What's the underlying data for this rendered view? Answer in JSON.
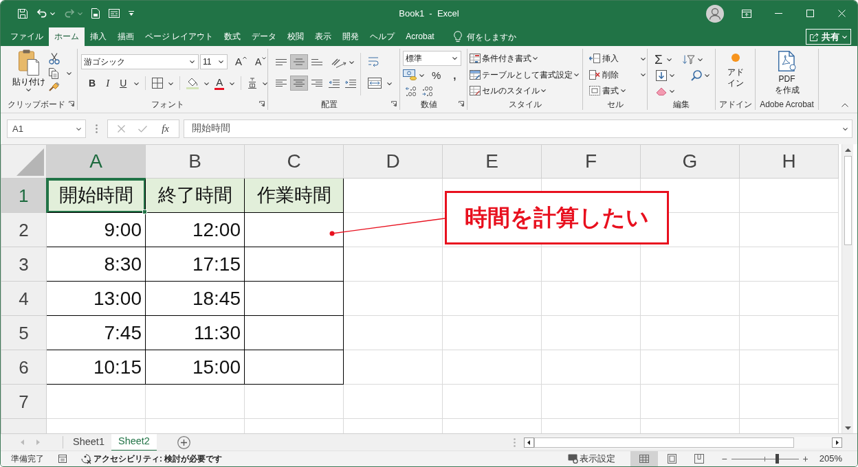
{
  "window": {
    "title": "Book1  -  Excel"
  },
  "quick_access": [
    {
      "kind": "save",
      "disabled": false
    },
    {
      "kind": "undo",
      "disabled": false
    },
    {
      "kind": "redo",
      "disabled": true
    },
    {
      "kind": "page",
      "disabled": false
    },
    {
      "kind": "form",
      "disabled": false
    }
  ],
  "ribbon_tabs": [
    {
      "label": "ファイル",
      "selected": false
    },
    {
      "label": "ホーム",
      "selected": true
    },
    {
      "label": "挿入",
      "selected": false
    },
    {
      "label": "描画",
      "selected": false
    },
    {
      "label": "ページ レイアウト",
      "selected": false
    },
    {
      "label": "数式",
      "selected": false
    },
    {
      "label": "データ",
      "selected": false
    },
    {
      "label": "校閲",
      "selected": false
    },
    {
      "label": "表示",
      "selected": false
    },
    {
      "label": "開発",
      "selected": false
    },
    {
      "label": "ヘルプ",
      "selected": false
    },
    {
      "label": "Acrobat",
      "selected": false
    }
  ],
  "tell_me": {
    "label": "何をしますか"
  },
  "share_button": {
    "label": "共有"
  },
  "ribbon_groups": [
    {
      "kind": "clipboard",
      "label": "クリップボード",
      "launcher": true,
      "paste": "貼り付け"
    },
    {
      "kind": "font",
      "label": "フォント",
      "launcher": true,
      "font_name": "游ゴシック",
      "font_size": "11",
      "grow": "A",
      "shrink": "A",
      "bold": "B",
      "italic": "I",
      "underline": "U",
      "font_color": "A"
    },
    {
      "kind": "alignment",
      "label": "配置",
      "launcher": true,
      "vertical": [
        {
          "kind": "top",
          "selected": false
        },
        {
          "kind": "middle",
          "selected": true
        },
        {
          "kind": "bottom",
          "selected": false
        }
      ],
      "horizontal": [
        {
          "kind": "left",
          "selected": false
        },
        {
          "kind": "center",
          "selected": true
        },
        {
          "kind": "right",
          "selected": false
        }
      ]
    },
    {
      "kind": "number",
      "label": "数値",
      "launcher": true,
      "format": "標準",
      "percent": "%",
      "comma": ","
    },
    {
      "kind": "styles",
      "label": "スタイル",
      "launcher": false,
      "items": [
        {
          "kind": "conditional",
          "label": "条件付き書式"
        },
        {
          "kind": "table",
          "label": "テーブルとして書式設定"
        },
        {
          "kind": "cell",
          "label": "セルのスタイル"
        }
      ]
    },
    {
      "kind": "cells",
      "label": "セル",
      "launcher": false,
      "items": [
        {
          "kind": "insert",
          "label": "挿入"
        },
        {
          "kind": "delete",
          "label": "削除"
        },
        {
          "kind": "format",
          "label": "書式"
        }
      ]
    },
    {
      "kind": "editing",
      "label": "編集",
      "launcher": false,
      "sum": "Σ"
    },
    {
      "kind": "addins",
      "label": "アドイン",
      "launcher": false,
      "button": "アドイン"
    },
    {
      "kind": "acrobat",
      "label": "Adobe Acrobat",
      "launcher": false,
      "button": "PDF を作成"
    }
  ],
  "formula_bar": {
    "name_box": "A1",
    "buttons": [
      {
        "kind": "cancel",
        "disabled": true
      },
      {
        "kind": "enter",
        "disabled": true
      }
    ],
    "function_button": "fx",
    "value": "開始時間"
  },
  "grid": {
    "columns": [
      {
        "label": "A",
        "selected": true
      },
      {
        "label": "B",
        "selected": false
      },
      {
        "label": "C",
        "selected": false
      },
      {
        "label": "D",
        "selected": false
      },
      {
        "label": "E",
        "selected": false
      },
      {
        "label": "F",
        "selected": false
      },
      {
        "label": "G",
        "selected": false
      },
      {
        "label": "H",
        "selected": false
      }
    ],
    "rows": [
      {
        "label": "1",
        "selected": true
      },
      {
        "label": "2",
        "selected": false
      },
      {
        "label": "3",
        "selected": false
      },
      {
        "label": "4",
        "selected": false
      },
      {
        "label": "5",
        "selected": false
      },
      {
        "label": "6",
        "selected": false
      },
      {
        "label": "7",
        "selected": false
      }
    ],
    "table": {
      "header": [
        "開始時間",
        "終了時間",
        "作業時間"
      ],
      "rows": [
        [
          "9:00",
          "12:00"
        ],
        [
          "8:30",
          "17:15"
        ],
        [
          "13:00",
          "18:45"
        ],
        [
          "7:45",
          "11:30"
        ],
        [
          "10:15",
          "15:00"
        ]
      ]
    }
  },
  "callout": {
    "text": "時間を計算したい"
  },
  "sheet_tabs": [
    {
      "label": "Sheet1",
      "selected": false
    },
    {
      "label": "Sheet2",
      "selected": true
    }
  ],
  "status_bar": {
    "status": "準備完了",
    "accessibility": "アクセシビリティ: 検討が必要です",
    "display_settings": "表示設定",
    "views": [
      {
        "kind": "normal",
        "selected": true
      },
      {
        "kind": "page_layout",
        "selected": false
      },
      {
        "kind": "page_break",
        "selected": false
      }
    ],
    "zoom": {
      "zoom_out": "−",
      "zoom_in": "+",
      "level": 0.68,
      "reading": "205%"
    }
  }
}
